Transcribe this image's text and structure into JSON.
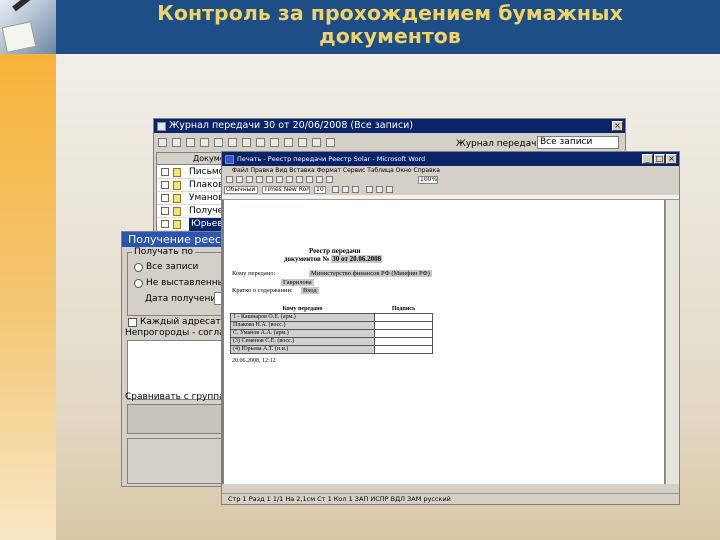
{
  "header": {
    "title": "Контроль за прохождением бумажных\nдокументов",
    "colors": {
      "background": "#1d4f86",
      "title": "#f0d36a",
      "band": "#f6b33a"
    }
  },
  "journal_window": {
    "title": "Журнал передачи 30 от 20/06/2008 (Все записи)",
    "filter_label": "Журнал передачи:",
    "filter_value": "Все записи",
    "filter_suffix": "Все",
    "column_header": "Документ",
    "rows": [
      "Письмо",
      "Плакова",
      "Уманов",
      "Получение",
      "Юрьева"
    ],
    "selected_row": 4
  },
  "receive_dialog": {
    "title": "Получение реестра",
    "group_label": "Получать по",
    "option1": "Все записи",
    "option2": "Не выставленные в ре",
    "date_label": "Дата получения с:",
    "checkbox_label": "Каждый адресат в сво",
    "note_label": "Непрогороды - согласовать",
    "compare_label": "Сравнивать с группами док"
  },
  "word_window": {
    "title": "Печать - Реестр передачи Реестр Solar - Microsoft Word",
    "menu": "Файл Правка Вид Вставка Формат Сервис Таблица Окно Справка",
    "style_value": "Обычный",
    "font_value": "Times New Roman",
    "size_value": "10",
    "zoom_value": "100%",
    "status": "Стр 1   Разд 1   1/1   На 2,1см   Ст 1   Кол 1   ЗАП   ИСПР   ВДЛ   ЗАМ   русский"
  },
  "document": {
    "title_line1": "Реестр передачи",
    "title_line2_prefix": "документов № ",
    "title_line2_hl": "30 от 20.06.2008",
    "to_label": "Кому передано:",
    "to_value": "Министерство финансов РФ (Минфин РФ)",
    "to_person": "Гаврилова",
    "copy_label": "Кратко о содержании:",
    "copy_value": "Вход",
    "table_header": [
      "Кому передано",
      "Подпись"
    ],
    "table_rows": [
      "1 - Кашнаров О.Е. (арм.)",
      "Плакова Н.А. (восс.)",
      "С. Уманов А.А. (арм.)",
      "(3) Семенов С.Е. (восс.)",
      "(4) Юрьева А.Т. (н.и.)"
    ],
    "footer": "20.06.2008, 12:12"
  }
}
